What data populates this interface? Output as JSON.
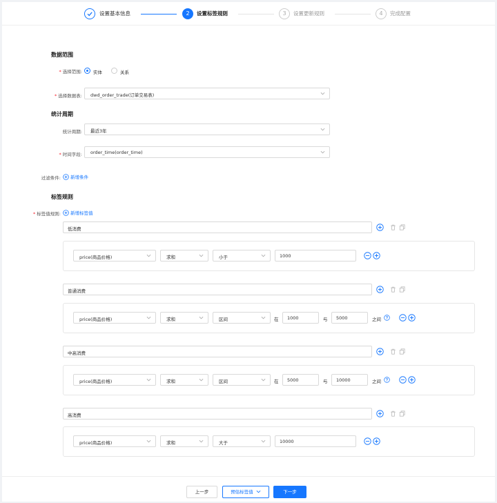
{
  "steps": [
    {
      "num": "1",
      "label": "设置基本信息",
      "state": "done"
    },
    {
      "num": "2",
      "label": "设置标签规则",
      "state": "active"
    },
    {
      "num": "3",
      "label": "设置更新规则",
      "state": "wait"
    },
    {
      "num": "4",
      "label": "完成配置",
      "state": "wait"
    }
  ],
  "data_range": {
    "section_title": "数据范围",
    "scope_label": "选择范围:",
    "scope_options": [
      "实体",
      "关系"
    ],
    "scope_selected": "实体",
    "table_label": "选择数据表:",
    "table_value": "dwd_order_trade(订单交易表)"
  },
  "stat_period": {
    "section_title": "统计周期",
    "period_label": "统计周期:",
    "period_value": "最近3年",
    "time_field_label": "时间字段:",
    "time_field_value": "order_time(order_time)"
  },
  "filter": {
    "label": "过滤条件:",
    "add_link": "新增条件"
  },
  "tag_rules": {
    "section_title": "标签规则",
    "rule_label": "标签值规则:",
    "add_link": "新增标签值",
    "rules": [
      {
        "name": "低消费",
        "field": "price(商品价格)",
        "agg": "求和",
        "op": "小于",
        "v1": "1000"
      },
      {
        "name": "普通消费",
        "field": "price(商品价格)",
        "agg": "求和",
        "op": "区间",
        "in": "在",
        "v1": "1000",
        "and": "与",
        "v2": "5000",
        "between": "之间"
      },
      {
        "name": "中高消费",
        "field": "price(商品价格)",
        "agg": "求和",
        "op": "区间",
        "in": "在",
        "v1": "5000",
        "and": "与",
        "v2": "10000",
        "between": "之间"
      },
      {
        "name": "高消费",
        "field": "price(商品价格)",
        "agg": "求和",
        "op": "大于",
        "v1": "10000"
      }
    ]
  },
  "footer": {
    "prev": "上一步",
    "estimate": "预估标签值",
    "next": "下一步"
  },
  "colors": {
    "primary": "#1677ff",
    "required": "#f5222d",
    "border": "#d9d9d9"
  }
}
